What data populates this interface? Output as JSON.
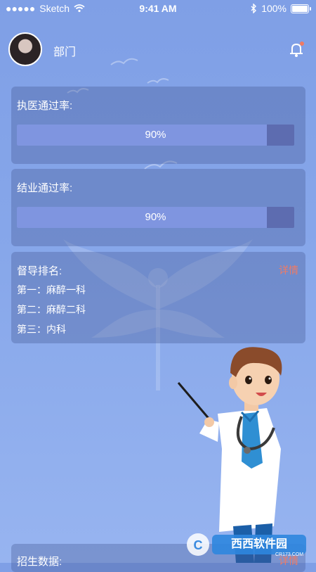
{
  "status_bar": {
    "carrier": "Sketch",
    "time": "9:41 AM",
    "battery": "100%"
  },
  "header": {
    "department": "部门"
  },
  "pass_rate_cards": [
    {
      "title": "执医通过率:",
      "value_label": "90%",
      "value": 0.9
    },
    {
      "title": "结业通过率:",
      "value_label": "90%",
      "value": 0.9
    }
  ],
  "supervision": {
    "title": "督导排名:",
    "detail_label": "详情",
    "items": [
      "第一：麻醉一科",
      "第二：麻醉二科",
      "第三：内科"
    ]
  },
  "enrollment": {
    "title": "招生数据:",
    "detail_label": "详情"
  },
  "watermark": {
    "brand": "西西软件园",
    "domain": "CR173.COM"
  },
  "colors": {
    "accent_detail": "#f07a63",
    "bar_track": "#5d6cb0",
    "bar_fill": "#7f95e0"
  }
}
